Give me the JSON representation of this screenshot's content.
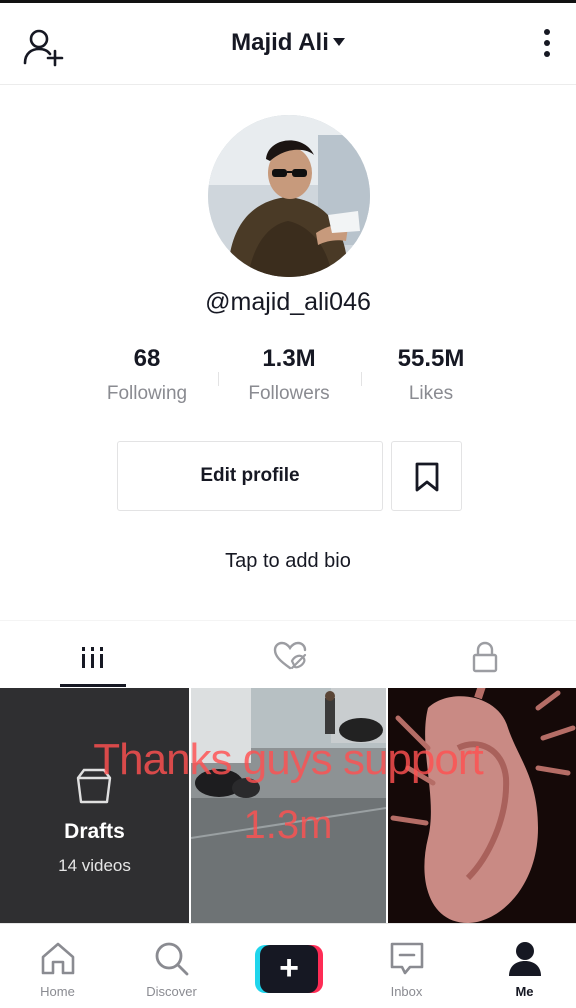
{
  "header": {
    "title": "Majid Ali"
  },
  "profile": {
    "handle": "@majid_ali046",
    "bio_prompt": "Tap to add bio",
    "edit_label": "Edit profile"
  },
  "stats": [
    {
      "value": "68",
      "label": "Following"
    },
    {
      "value": "1.3M",
      "label": "Followers"
    },
    {
      "value": "55.5M",
      "label": "Likes"
    }
  ],
  "tabs": [
    {
      "icon": "videos-grid-icon"
    },
    {
      "icon": "liked-hidden-icon"
    },
    {
      "icon": "lock-icon"
    }
  ],
  "drafts": {
    "title": "Drafts",
    "count": "14 videos"
  },
  "overlay": {
    "line1": "Thanks guys support",
    "line2": "1.3m"
  },
  "bottom_nav": [
    {
      "label": "Home",
      "icon": "home-icon"
    },
    {
      "label": "Discover",
      "icon": "search-icon"
    },
    {
      "label": "",
      "icon": "plus-icon"
    },
    {
      "label": "Inbox",
      "icon": "inbox-icon"
    },
    {
      "label": "Me",
      "icon": "profile-icon"
    }
  ],
  "colors": {
    "accent_pink": "#fe2c55",
    "accent_cyan": "#20d5ec",
    "text_dark": "#161823",
    "text_muted": "#8a8b91",
    "overlay_text": "#ff5050"
  }
}
